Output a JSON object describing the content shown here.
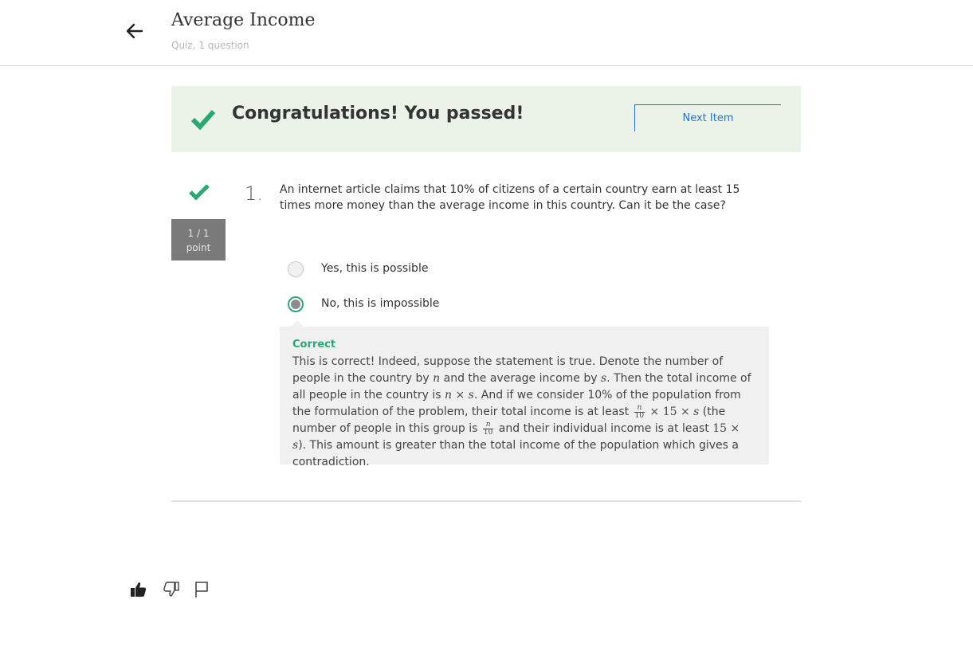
{
  "header": {
    "title": "Average Income",
    "subtitle": "Quiz, 1 question"
  },
  "banner": {
    "message": "Congratulations! You passed!",
    "next_label": "Next Item"
  },
  "question": {
    "number": "1.",
    "text": "An internet article claims that 10% of citizens of a certain country earn at least 15 times more money than the average income in this country. Can it be the case?",
    "score": "1 / 1",
    "score_unit": "point",
    "options": [
      {
        "label": "Yes, this is possible",
        "selected": false
      },
      {
        "label": "No, this is impossible",
        "selected": true
      }
    ]
  },
  "feedback": {
    "title": "Correct",
    "t1": "This is correct! Indeed, suppose the statement is true. Denote the number of people in the country by ",
    "t2": " and the average income by ",
    "t3": ". Then the total income of all people in the country is ",
    "t4": ". And if we consider 10% of the population from the formulation of the problem, their total income is at least ",
    "t5": " (the number of people in this group is ",
    "t6": " and their individual income is at least ",
    "t7": "). This amount is greater than the total income of the population which gives a contradiction.",
    "var_n": "n",
    "var_s": "s",
    "times": "×",
    "num_15": "15",
    "den_10": "10"
  },
  "colors": {
    "accent_green": "#2aa872",
    "link_blue": "#2a73cc",
    "banner_bg": "#ebf3e8",
    "feedback_bg": "#f0f0f0"
  },
  "icons": [
    "arrow-left-icon",
    "checkmark-icon",
    "thumbs-up-icon",
    "thumbs-down-icon",
    "flag-icon"
  ]
}
